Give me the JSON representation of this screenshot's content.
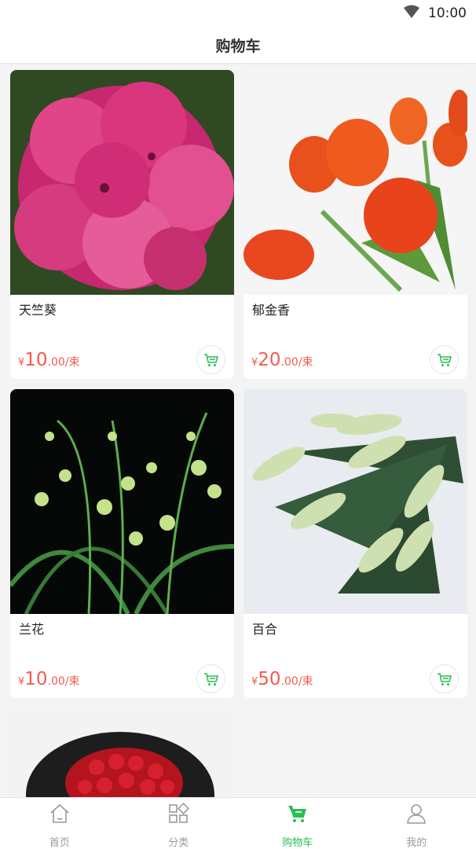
{
  "status_bar": {
    "time": "10:00"
  },
  "header": {
    "title": "购物车"
  },
  "products": [
    {
      "name": "天竺葵",
      "currency": "¥",
      "price_int": "10",
      "price_dec": ".00",
      "unit": "/束",
      "image": "geranium-photo"
    },
    {
      "name": "郁金香",
      "currency": "¥",
      "price_int": "20",
      "price_dec": ".00",
      "unit": "/束",
      "image": "tulip-photo"
    },
    {
      "name": "兰花",
      "currency": "¥",
      "price_int": "10",
      "price_dec": ".00",
      "unit": "/束",
      "image": "orchid-photo"
    },
    {
      "name": "百合",
      "currency": "¥",
      "price_int": "50",
      "price_dec": ".00",
      "unit": "/束",
      "image": "lily-photo"
    },
    {
      "name": "",
      "image": "rose-bouquet-photo"
    }
  ],
  "tabs": [
    {
      "label": "首页",
      "icon": "home-icon",
      "active": false
    },
    {
      "label": "分类",
      "icon": "category-icon",
      "active": false
    },
    {
      "label": "购物车",
      "icon": "cart-icon",
      "active": true
    },
    {
      "label": "我的",
      "icon": "user-icon",
      "active": false
    }
  ],
  "colors": {
    "accent": "#2bbe55",
    "price": "#f25b4e",
    "background": "#f4f4f4"
  }
}
